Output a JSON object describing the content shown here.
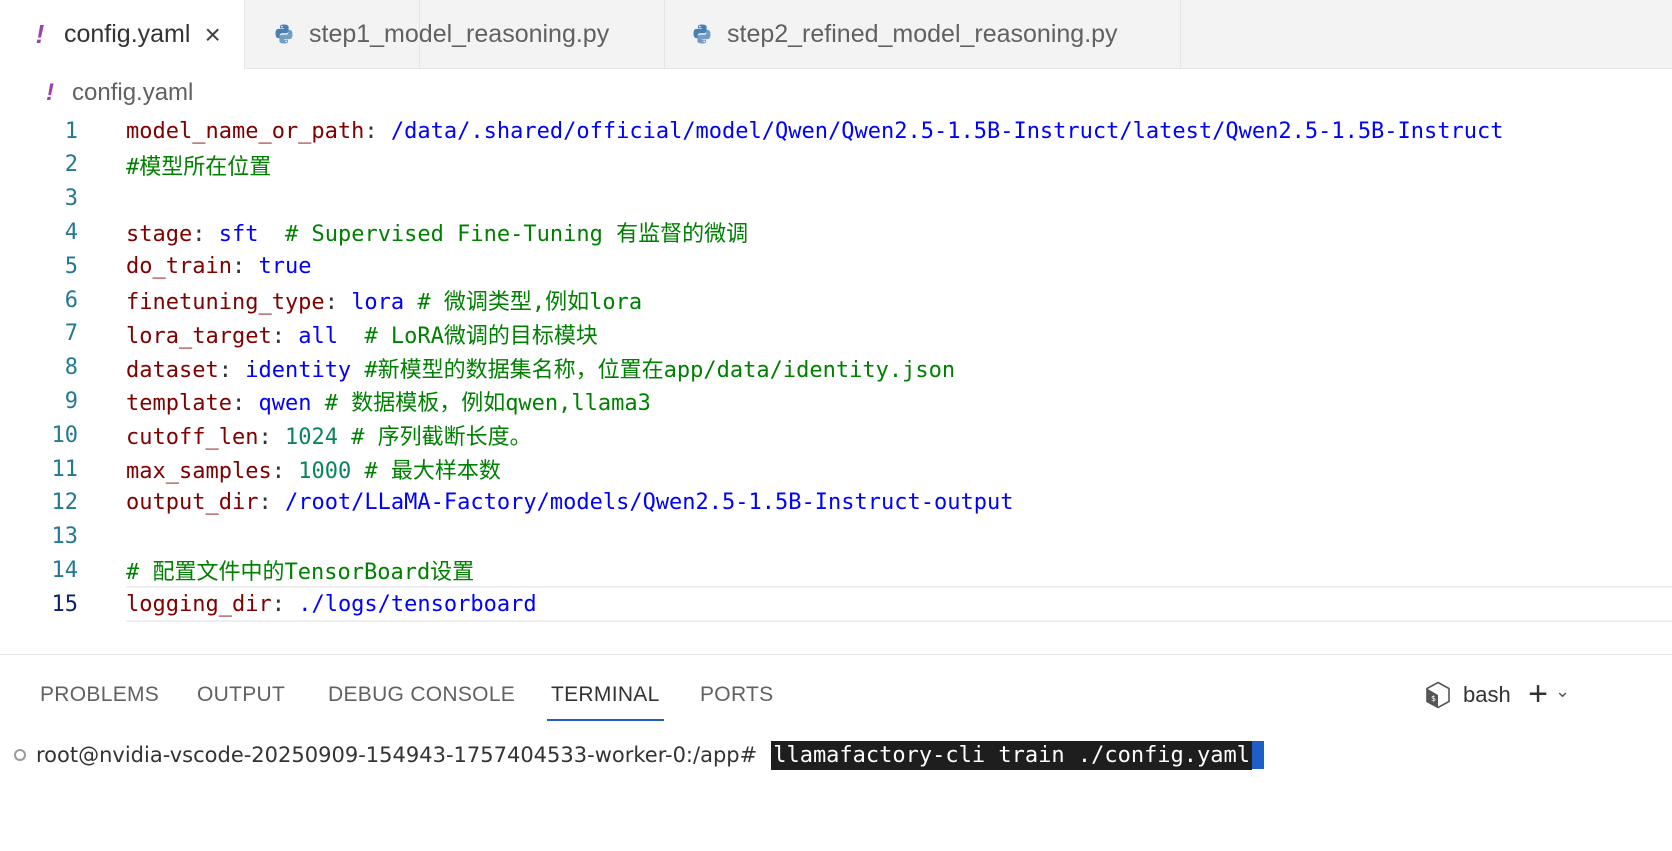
{
  "tabs": [
    {
      "label": "config.yaml",
      "icon": "yaml-exclamation-icon",
      "active": true,
      "closable": true
    },
    {
      "label": "step1_model_reasoning.py",
      "icon": "python-icon",
      "active": false
    },
    {
      "label": "step2_refined_model_reasoning.py",
      "icon": "python-icon",
      "active": false
    }
  ],
  "tab_icon_glyph": "!",
  "close_glyph": "×",
  "breadcrumb": {
    "icon": "yaml-exclamation-icon",
    "label": "config.yaml"
  },
  "editor": {
    "current_line": 15,
    "lines": [
      {
        "n": "1",
        "key": "model_name_or_path",
        "sep": ": ",
        "value": "/data/.shared/official/model/Qwen/Qwen2.5-1.5B-Instruct/latest/Qwen2.5-1.5B-Instruct",
        "comment": ""
      },
      {
        "n": "2",
        "key": "",
        "sep": "",
        "value": "",
        "comment": "#模型所在位置"
      },
      {
        "n": "3",
        "key": "",
        "sep": "",
        "value": "",
        "comment": ""
      },
      {
        "n": "4",
        "key": "stage",
        "sep": ": ",
        "value": "sft",
        "comment": "  # Supervised Fine-Tuning 有监督的微调"
      },
      {
        "n": "5",
        "key": "do_train",
        "sep": ": ",
        "value": "true",
        "comment": ""
      },
      {
        "n": "6",
        "key": "finetuning_type",
        "sep": ": ",
        "value": "lora",
        "comment": " # 微调类型,例如lora"
      },
      {
        "n": "7",
        "key": "lora_target",
        "sep": ": ",
        "value": "all",
        "comment": "  # LoRA微调的目标模块"
      },
      {
        "n": "8",
        "key": "dataset",
        "sep": ": ",
        "value": "identity",
        "comment": " #新模型的数据集名称，位置在app/data/identity.json"
      },
      {
        "n": "9",
        "key": "template",
        "sep": ": ",
        "value": "qwen",
        "comment": " # 数据模板，例如qwen,llama3"
      },
      {
        "n": "10",
        "key": "cutoff_len",
        "sep": ": ",
        "num": "1024",
        "comment": " # 序列截断长度。"
      },
      {
        "n": "11",
        "key": "max_samples",
        "sep": ": ",
        "num": "1000",
        "comment": " # 最大样本数"
      },
      {
        "n": "12",
        "key": "output_dir",
        "sep": ": ",
        "value": "/root/LLaMA-Factory/models/Qwen2.5-1.5B-Instruct-output",
        "comment": ""
      },
      {
        "n": "13",
        "key": "",
        "sep": "",
        "value": "",
        "comment": ""
      },
      {
        "n": "14",
        "key": "",
        "sep": "",
        "value": "",
        "comment": "# 配置文件中的TensorBoard设置"
      },
      {
        "n": "15",
        "key": "logging_dir",
        "sep": ": ",
        "value": "./logs/tensorboard",
        "comment": ""
      }
    ]
  },
  "panel": {
    "tabs": [
      {
        "label": "PROBLEMS",
        "active": false
      },
      {
        "label": "OUTPUT",
        "active": false
      },
      {
        "label": "DEBUG CONSOLE",
        "active": false
      },
      {
        "label": "TERMINAL",
        "active": true
      },
      {
        "label": "PORTS",
        "active": false
      }
    ],
    "shell_label": "bash",
    "plus_glyph": "+",
    "chevron_glyph": "⌄",
    "terminal": {
      "prompt": "root@nvidia-vscode-20250909-154943-1757404533-worker-0:/app#",
      "command": "llamafactory-cli train ./config.yaml"
    }
  },
  "colors": {
    "key": "#800000",
    "value": "#0000ff",
    "number": "#098658",
    "comment": "#008000",
    "line_number": "#237893",
    "accent": "#1e5fc7",
    "yaml_icon": "#9b3fb3"
  }
}
